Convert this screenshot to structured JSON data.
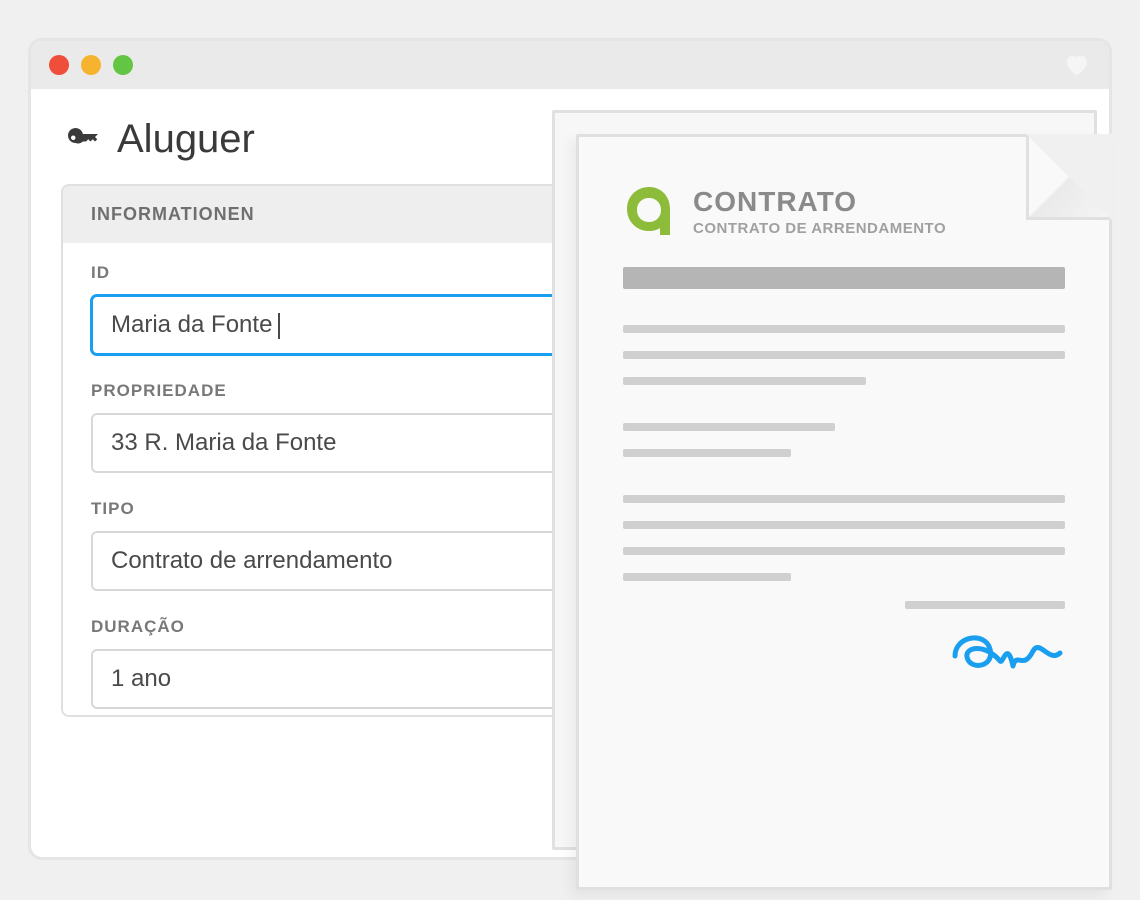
{
  "window": {
    "heart_icon": "heart"
  },
  "page": {
    "title": "Aluguer",
    "icon": "key-icon"
  },
  "form": {
    "section_title": "INFORMATIONEN",
    "fields": {
      "id": {
        "label": "ID",
        "value": "Maria da Fonte"
      },
      "property": {
        "label": "PROPRIEDADE",
        "value": "33 R. Maria da Fonte"
      },
      "type": {
        "label": "TIPO",
        "value": "Contrato de arrendamento"
      },
      "duration": {
        "label": "DURAÇÃO",
        "value": "1 ano"
      }
    }
  },
  "document": {
    "title": "CONTRATO",
    "subtitle": "CONTRATO DE ARRENDAMENTO",
    "logo_color": "#8dbb3a",
    "signature_color": "#1a9ff0"
  }
}
